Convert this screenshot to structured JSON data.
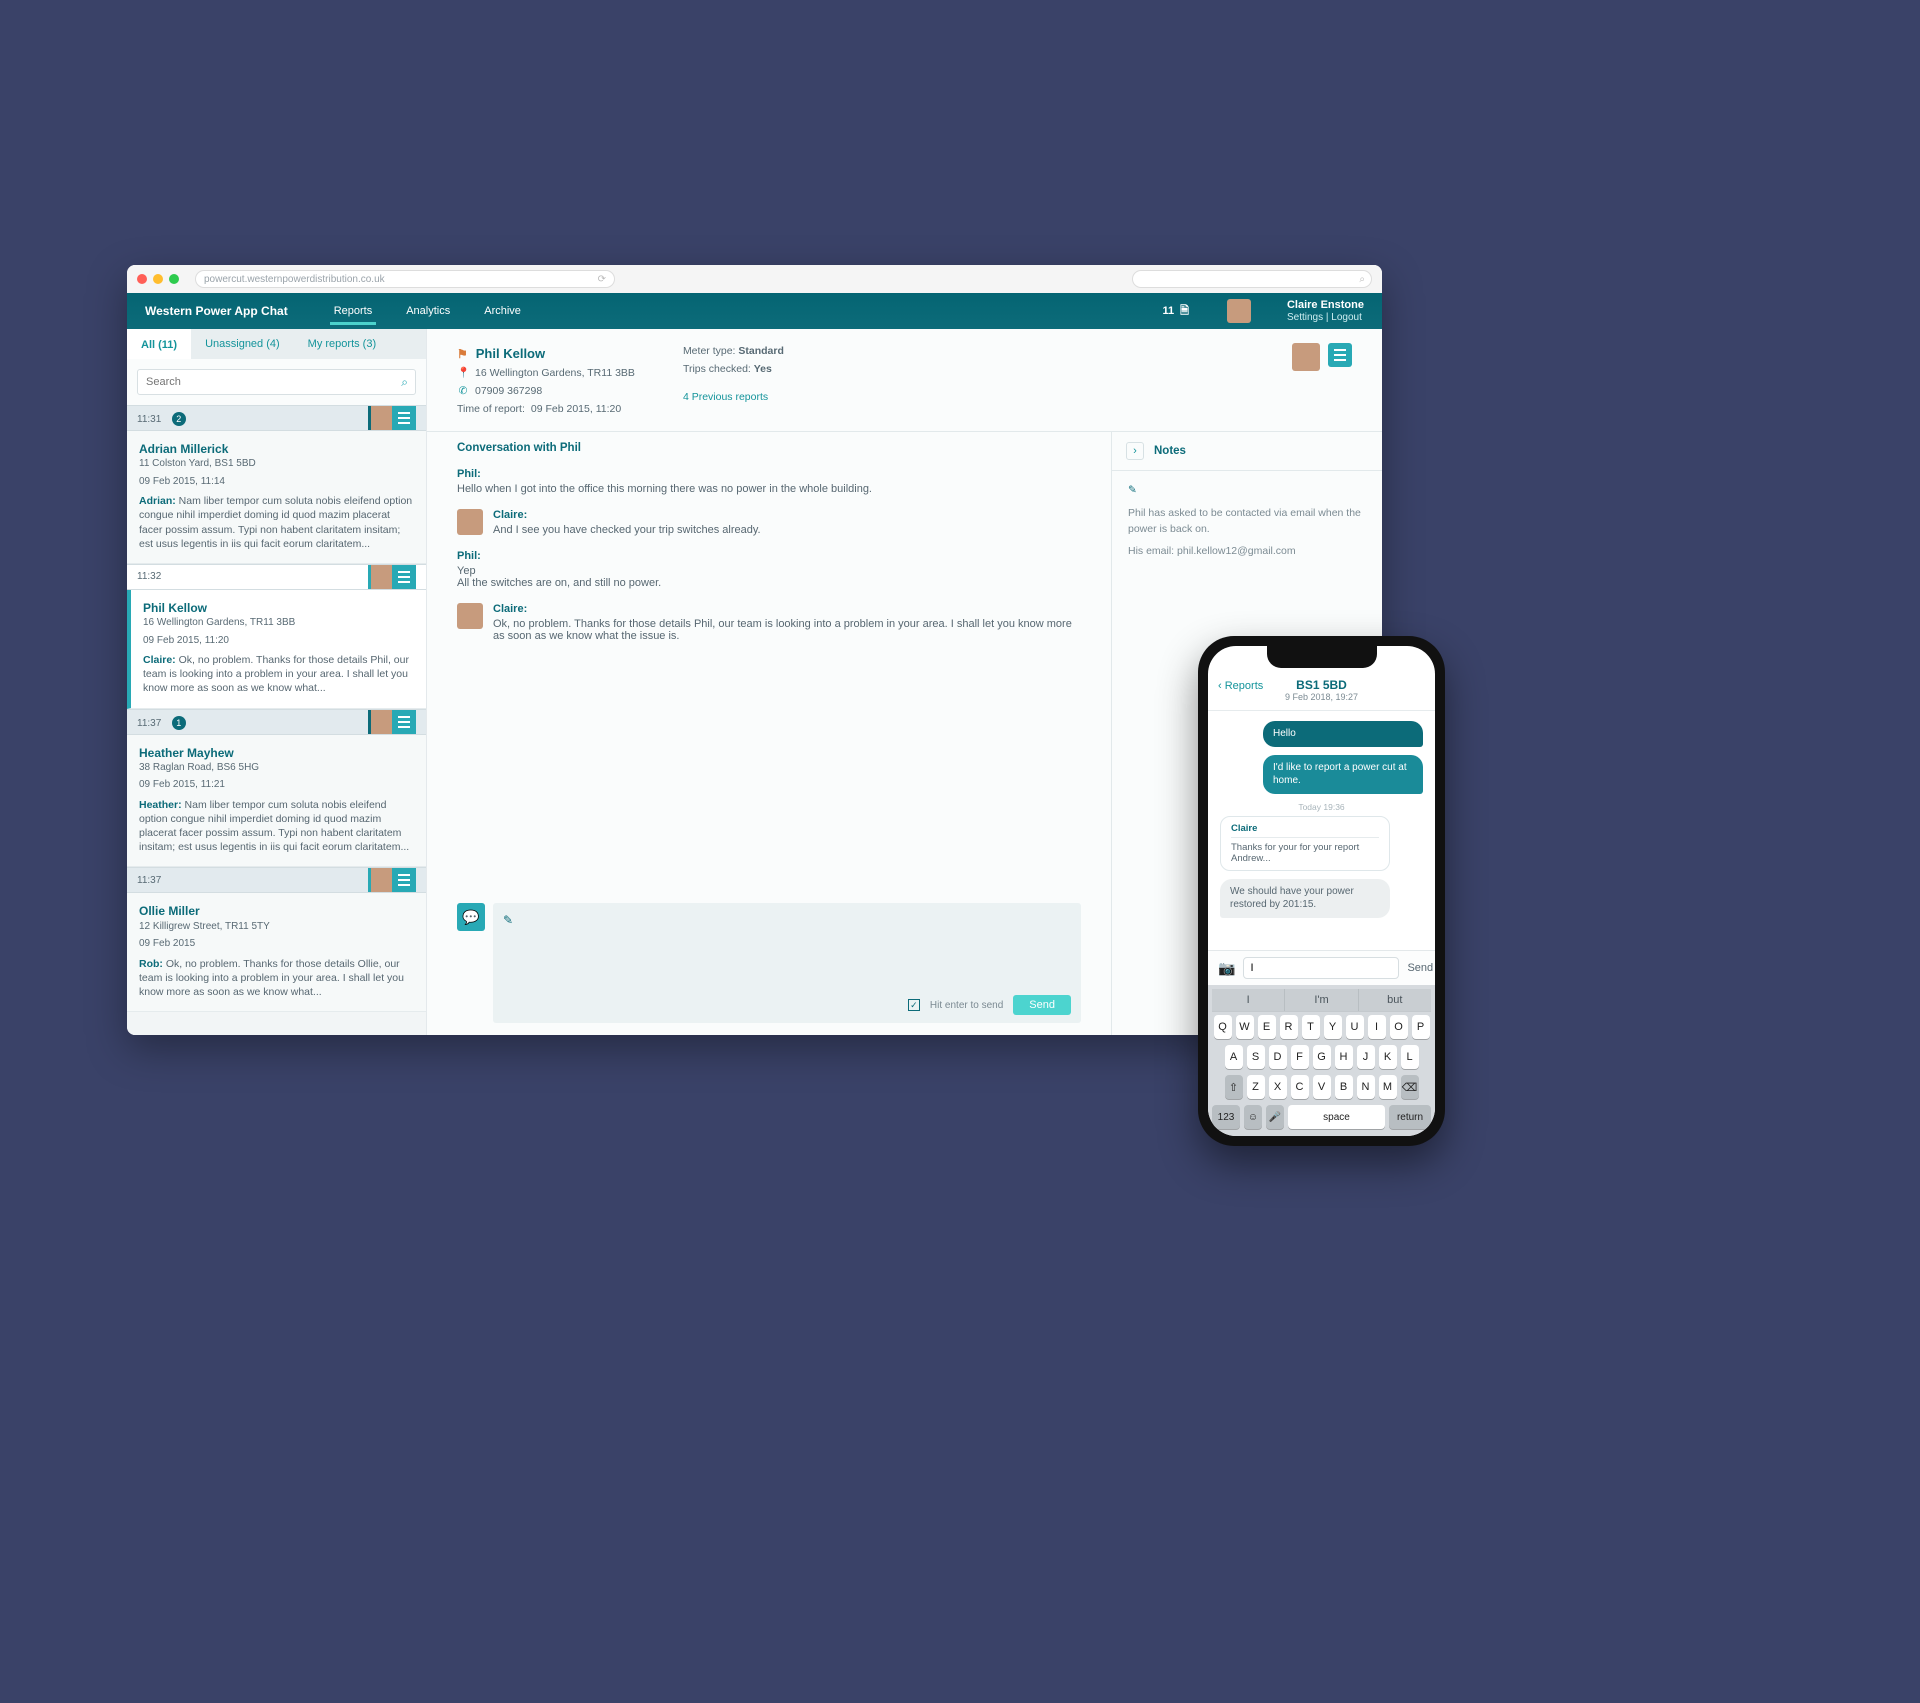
{
  "browser": {
    "url": "powercut.westernpowerdistribution.co.uk"
  },
  "header": {
    "brand": "Western Power App Chat",
    "nav": [
      "Reports",
      "Analytics",
      "Archive"
    ],
    "counter": "11",
    "user_name": "Claire Enstone",
    "user_links": "Settings | Logout"
  },
  "tabs": {
    "all": "All (11)",
    "unassigned": "Unassigned (4)",
    "mine": "My reports (3)"
  },
  "search_placeholder": "Search",
  "reports": [
    {
      "time": "11:31",
      "badge": "2",
      "name": "Adrian Millerick",
      "addr": "11 Colston Yard, BS1 5BD",
      "date": "09 Feb 2015, 11:14",
      "who": "Adrian:",
      "snippet": "Nam liber tempor cum soluta nobis eleifend option congue nihil imperdiet doming id quod mazim placerat facer possim assum. Typi non habent claritatem insitam; est usus legentis in iis qui facit eorum claritatem..."
    },
    {
      "time": "11:32",
      "badge": "",
      "name": "Phil Kellow",
      "addr": "16 Wellington Gardens, TR11 3BB",
      "date": "09 Feb 2015, 11:20",
      "who": "Claire:",
      "snippet": "Ok, no problem. Thanks for those details Phil, our team is looking into a problem in your area. I shall let you know more as soon as we know what...",
      "active": true
    },
    {
      "time": "11:37",
      "badge": "1",
      "name": "Heather Mayhew",
      "addr": "38 Raglan Road, BS6 5HG",
      "date": "09 Feb 2015, 11:21",
      "who": "Heather:",
      "snippet": "Nam liber tempor cum soluta nobis eleifend option congue nihil imperdiet doming id quod mazim placerat facer possim assum. Typi non habent claritatem insitam; est usus legentis in iis qui facit eorum claritatem..."
    },
    {
      "time": "11:37",
      "badge": "",
      "name": "Ollie Miller",
      "addr": "12 Killigrew Street, TR11 5TY",
      "date": "09 Feb 2015",
      "who": "Rob:",
      "snippet": "Ok, no problem. Thanks for those details Ollie, our team is looking into a problem in your area. I shall let you know more as soon as we know what..."
    }
  ],
  "detail": {
    "name": "Phil Kellow",
    "addr": "16 Wellington Gardens, TR11 3BB",
    "phone": "07909 367298",
    "time_of_report_label": "Time of report: ",
    "time_of_report": "09 Feb 2015, 11:20",
    "meter_label": "Meter type: ",
    "meter": "Standard",
    "trips_label": "Trips checked: ",
    "trips": "Yes",
    "prev_link": "4 Previous reports"
  },
  "conversation": {
    "title": "Conversation with Phil",
    "messages": [
      {
        "from": "Phil:",
        "text": "Hello when I got into the office this morning there was no power in the whole building.",
        "av": false
      },
      {
        "from": "Claire:",
        "text": "And I see you have checked your trip switches already.",
        "av": true
      },
      {
        "from": "Phil:",
        "text0": "Yep",
        "text": "All the switches are on, and still no power.",
        "av": false
      },
      {
        "from": "Claire:",
        "text": "Ok, no problem. Thanks for those details Phil, our team is looking into a problem in your area. I shall let you know more as soon as we know what the issue is.",
        "av": true
      }
    ],
    "enter_label": "Hit enter to send",
    "send": "Send"
  },
  "notes": {
    "title": "Notes",
    "body1": "Phil has asked to be contacted via email when the power is back on.",
    "body2": "His email: phil.kellow12@gmail.com"
  },
  "phone": {
    "back": "Reports",
    "location": "BS1 5BD",
    "datetime": "9 Feb 2018, 19:27",
    "msg_hello": "Hello",
    "msg_report": "I'd like to report a power cut at home.",
    "ts": "Today 19:36",
    "claire": "Claire",
    "claire_msg": "Thanks for your for your report Andrew...",
    "restore": "We should have your power restored by 201:15.",
    "input_value": "I",
    "send": "Send",
    "suggest": [
      "I",
      "I'm",
      "but"
    ],
    "row1": [
      "Q",
      "W",
      "E",
      "R",
      "T",
      "Y",
      "U",
      "I",
      "O",
      "P"
    ],
    "row2": [
      "A",
      "S",
      "D",
      "F",
      "G",
      "H",
      "J",
      "K",
      "L"
    ],
    "row3": [
      "Z",
      "X",
      "C",
      "V",
      "B",
      "N",
      "M"
    ],
    "shift": "⇧",
    "del": "⌫",
    "k123": "123",
    "emoji": "☺",
    "mic": "🎤",
    "space": "space",
    "return": "return"
  }
}
